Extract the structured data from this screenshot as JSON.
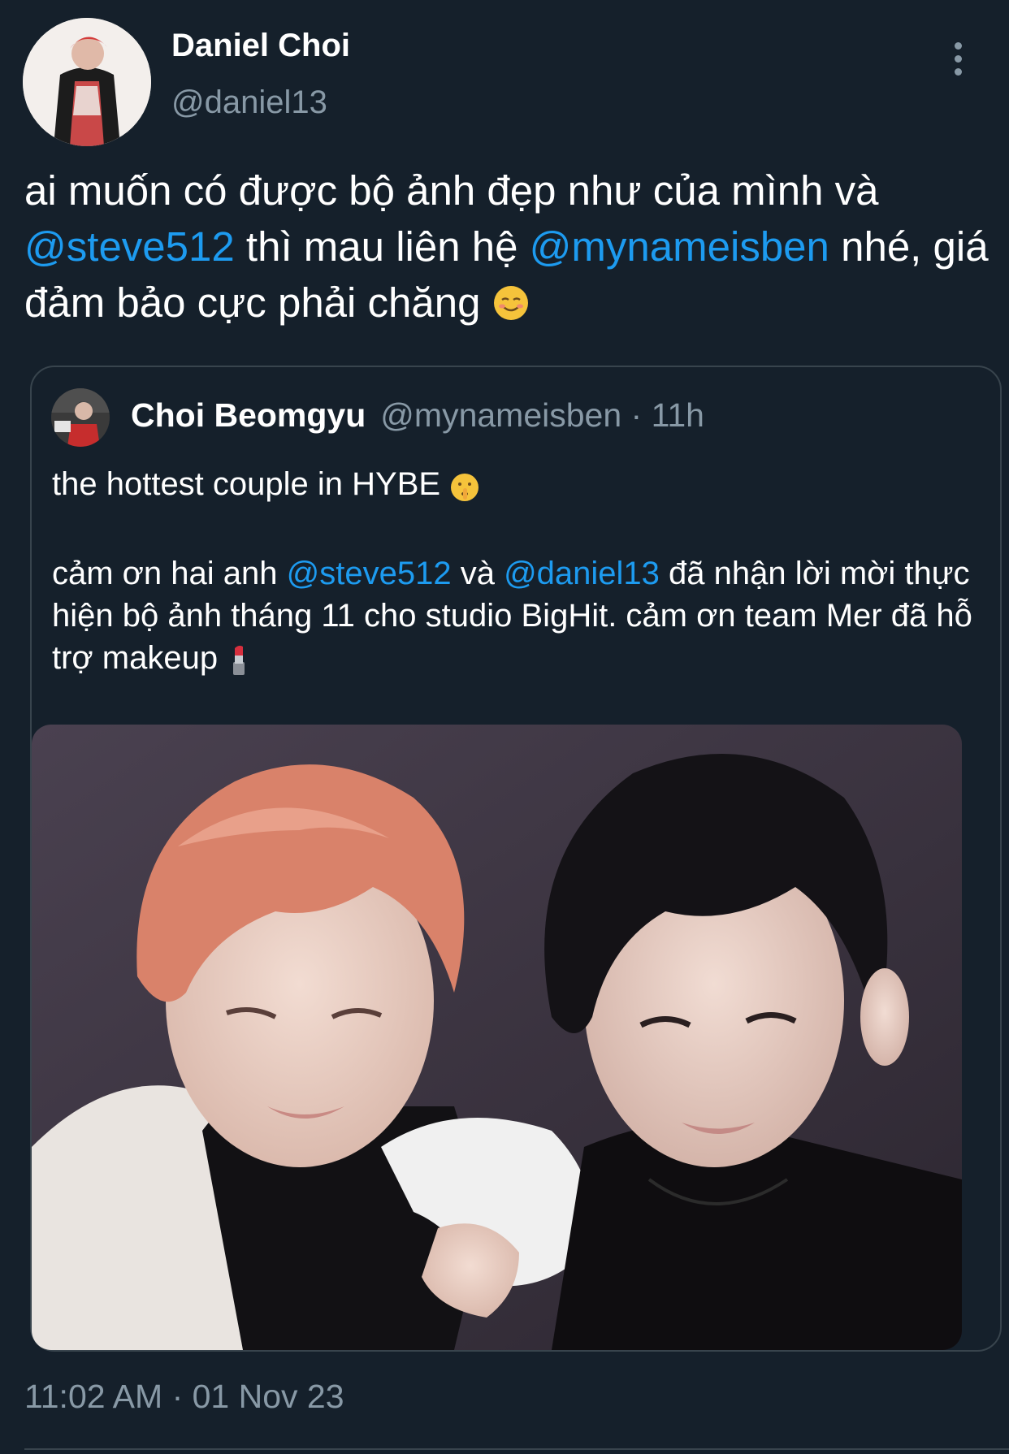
{
  "theme": {
    "background": "#15202b",
    "text": "#ffffff",
    "muted": "#8899a6",
    "link": "#1d9bf0",
    "border": "#38444d"
  },
  "author": {
    "name": "Daniel Choi",
    "handle": "@daniel13",
    "avatar_icon": "user-avatar"
  },
  "menu": {
    "icon": "more-vertical-icon"
  },
  "tweet": {
    "part1": "ai muốn có được bộ ảnh đẹp như của mình và ",
    "mention1": "@steve512",
    "part2": " thì mau liên hệ ",
    "mention2": "@mynameisben",
    "part3": " nhé, giá đảm bảo cực phải chăng ",
    "emoji": "smiling-face-icon"
  },
  "quote": {
    "name": "Choi Beomgyu",
    "meta": "@mynameisben · 11h",
    "line1": "the hottest couple in HYBE ",
    "line1_emoji": "shushing-face-icon",
    "line2_a": "cảm ơn hai anh ",
    "line2_mention1": "@steve512",
    "line2_b": " và ",
    "line2_mention2": "@daniel13",
    "line2_c": " đã nhận lời mời thực hiện bộ ảnh tháng 11 cho studio BigHit. cảm ơn team Mer đã hỗ trợ makeup ",
    "line2_emoji": "lipstick-icon",
    "image_icon": "photo-two-people"
  },
  "timestamp": "11:02 AM · 01 Nov 23"
}
